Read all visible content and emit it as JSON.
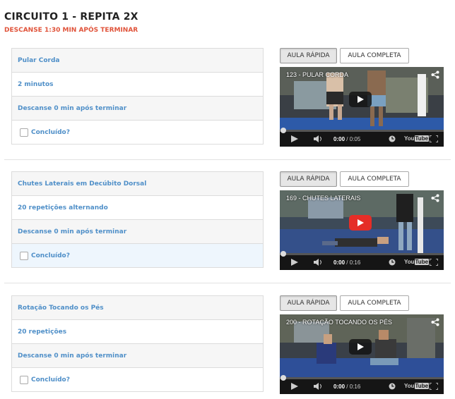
{
  "header": {
    "title": "CIRCUITO 1 - REPITA 2X",
    "subtitle": "DESCANSE 1:30 MIN APÓS TERMINAR"
  },
  "exercises": [
    {
      "name": "Pular Corda",
      "reps": "2 minutos",
      "rest": "Descanse 0 min após terminar",
      "done_label": "Concluído?",
      "btn_quick": "AULA RÁPIDA",
      "btn_full": "AULA COMPLETA",
      "video_title": "123 - PULAR CORDA",
      "time_current": "0:00",
      "time_total": "/ 0:05"
    },
    {
      "name": "Chutes Laterais em Decúbito Dorsal",
      "reps": "20 repetições alternando",
      "rest": "Descanse 0 min após terminar",
      "done_label": "Concluído?",
      "btn_quick": "AULA RÁPIDA",
      "btn_full": "AULA COMPLETA",
      "video_title": "169 - CHUTES LATERAIS",
      "time_current": "0:00",
      "time_total": "/ 0:16"
    },
    {
      "name": "Rotação Tocando os Pés",
      "reps": "20 repetições",
      "rest": "Descanse 0 min após terminar",
      "done_label": "Concluído?",
      "btn_quick": "AULA RÁPIDA",
      "btn_full": "AULA COMPLETA",
      "video_title": "200 - ROTAÇÃO TOCANDO OS PÉS",
      "time_current": "0:00",
      "time_total": "/ 0:16"
    }
  ],
  "icons": {
    "play": "play-icon",
    "volume": "volume-icon",
    "clock": "watch-later-icon",
    "youtube": "youtube-logo",
    "fullscreen": "fullscreen-icon",
    "share": "share-icon"
  },
  "player_brand": "You Tube",
  "colors": {
    "link_blue": "#4f8fc8",
    "accent_red": "#e0533a",
    "youtube_red": "#e52d27"
  }
}
